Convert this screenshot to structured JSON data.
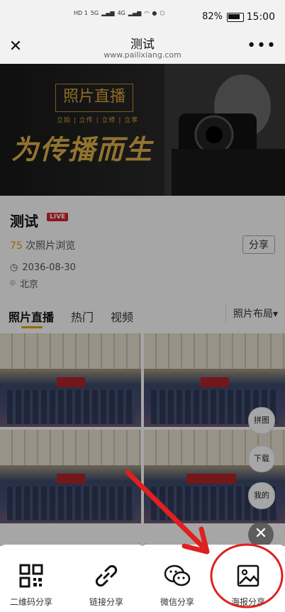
{
  "status_bar": {
    "signal_icons": [
      "HD 1",
      "HD 2",
      "5G",
      "4G"
    ],
    "battery": "82%",
    "time": "15:00"
  },
  "nav": {
    "title": "测试",
    "url": "www.pailixiang.com"
  },
  "banner": {
    "tag": "照片直播",
    "tag_sub": "立拍 | 立传 | 立修 | 立享",
    "slogan": "为传播而生"
  },
  "event": {
    "name": "测试",
    "live_badge": "LIVE",
    "views_count": "75",
    "views_label": "次照片浏览",
    "share": "分享",
    "date": "2036-08-30",
    "location": "北京"
  },
  "tabs": {
    "items": [
      "照片直播",
      "热门",
      "视频"
    ],
    "active": 0,
    "layout_label": "照片布局"
  },
  "fabs": {
    "collage": "拼图",
    "download": "下载",
    "mine": "我的"
  },
  "share_sheet": {
    "options": [
      {
        "label": "二维码分享",
        "icon": "qr-code-icon"
      },
      {
        "label": "链接分享",
        "icon": "link-icon"
      },
      {
        "label": "微信分享",
        "icon": "wechat-icon"
      },
      {
        "label": "海报分享",
        "icon": "image-icon"
      }
    ]
  },
  "colors": {
    "accent": "#e6a100",
    "live": "#d9232d",
    "annotation": "#e02020"
  }
}
